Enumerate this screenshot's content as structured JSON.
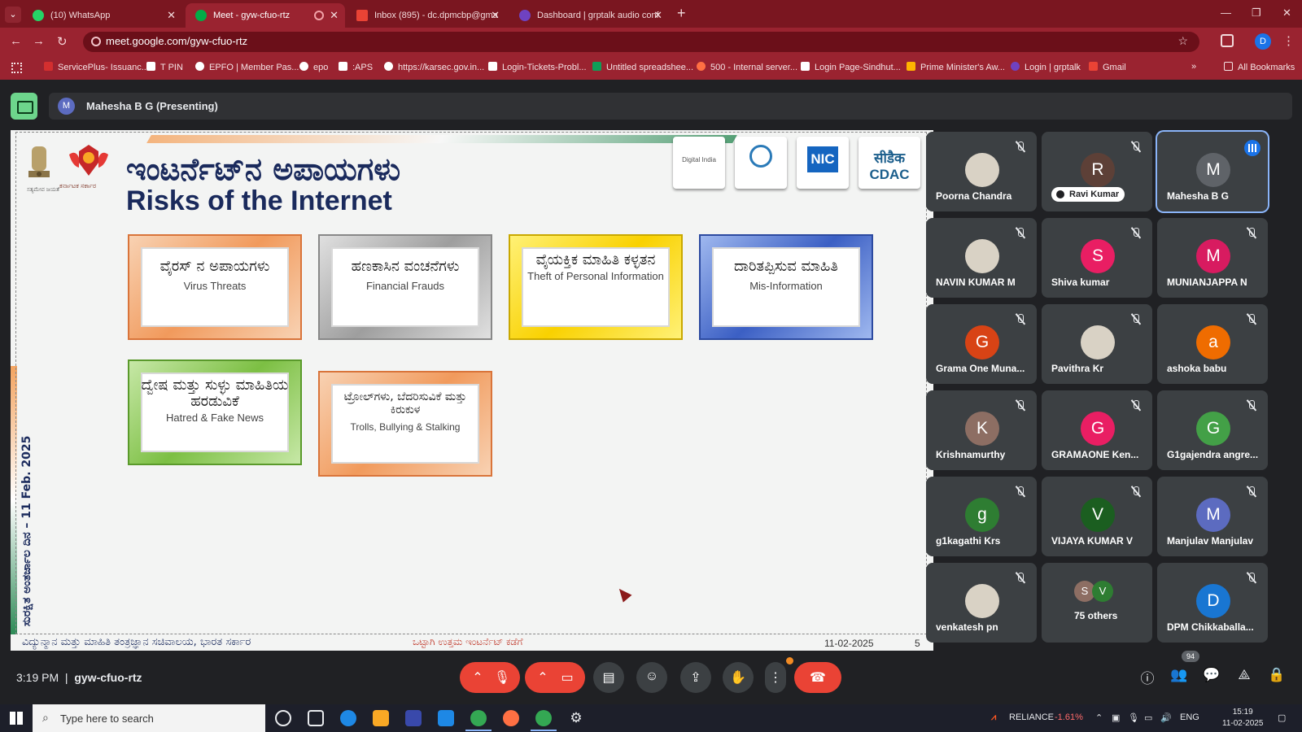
{
  "browser": {
    "tabs": [
      {
        "title": "(10) WhatsApp",
        "color": "#25d366"
      },
      {
        "title": "Meet - gyw-cfuo-rtz",
        "color": "#00ac47"
      },
      {
        "title": "Inbox (895) - dc.dpmcbp@gma",
        "color": "#ea4335"
      },
      {
        "title": "Dashboard | grptalk audio conf",
        "color": "#6f42c1"
      }
    ],
    "url": "meet.google.com/gyw-cfuo-rtz",
    "profile_initial": "D",
    "bookmarks": [
      {
        "label": "ServicePlus- Issuanc...",
        "color": "#d32f2f"
      },
      {
        "label": "T PIN",
        "color": "#ffffff"
      },
      {
        "label": "EPFO | Member Pas...",
        "color": "#ffffff"
      },
      {
        "label": "epo",
        "color": "#ffffff"
      },
      {
        "label": ":APS",
        "color": "#ffffff"
      },
      {
        "label": "https://karsec.gov.in...",
        "color": "#ffffff"
      },
      {
        "label": "Login-Tickets-Probl...",
        "color": "#ffffff"
      },
      {
        "label": "Untitled spreadshee...",
        "color": "#0f9d58"
      },
      {
        "label": "500 - Internal server...",
        "color": "#ff7043"
      },
      {
        "label": "Login Page-Sindhut...",
        "color": "#ffffff"
      },
      {
        "label": "Prime Minister's Aw...",
        "color": "#ffb300"
      },
      {
        "label": "Login | grptalk",
        "color": "#6f42c1"
      },
      {
        "label": "Gmail",
        "color": "#ea4335"
      }
    ],
    "more_bookmarks": "»",
    "all_bookmarks": "All Bookmarks"
  },
  "meet": {
    "presenter_initial": "M",
    "presenter_label": "Mahesha B G (Presenting)",
    "time": "3:19 PM",
    "meeting_code": "gyw-cfuo-rtz",
    "participant_count": "94",
    "participants": [
      {
        "name": "Poorna Chandra",
        "initial": "",
        "color": "#d9d2c5",
        "photo": true
      },
      {
        "name": "Ravi Kumar",
        "initial": "R",
        "color": "#5d4037",
        "pill": true
      },
      {
        "name": "Mahesha B G",
        "initial": "M",
        "color": "#5f6368",
        "active": true
      },
      {
        "name": "NAVIN KUMAR M",
        "initial": "",
        "color": "#d9d2c5",
        "photo": true
      },
      {
        "name": "Shiva kumar",
        "initial": "S",
        "color": "#e91e63"
      },
      {
        "name": "MUNIANJAPPA N",
        "initial": "M",
        "color": "#d81b60"
      },
      {
        "name": "Grama One Muna...",
        "initial": "G",
        "color": "#d84315"
      },
      {
        "name": "Pavithra Kr",
        "initial": "",
        "color": "#d9d2c5",
        "photo": true
      },
      {
        "name": "ashoka babu",
        "initial": "a",
        "color": "#ef6c00"
      },
      {
        "name": "Krishnamurthy",
        "initial": "K",
        "color": "#8d6e63"
      },
      {
        "name": "GRAMAONE Ken...",
        "initial": "G",
        "color": "#e91e63"
      },
      {
        "name": "G1gajendra angre...",
        "initial": "G",
        "color": "#43a047"
      },
      {
        "name": "g1kagathi Krs",
        "initial": "g",
        "color": "#2e7d32"
      },
      {
        "name": "VIJAYA KUMAR V",
        "initial": "V",
        "color": "#1b5e20"
      },
      {
        "name": "Manjulav Manjulav",
        "initial": "M",
        "color": "#5c6bc0"
      },
      {
        "name": "venkatesh pn",
        "initial": "",
        "color": "#d9d2c5",
        "photo": true
      },
      {
        "name": "75 others",
        "initial": "",
        "color": "#3c4043",
        "others": true
      },
      {
        "name": "DPM Chikkaballa...",
        "initial": "D",
        "color": "#1976d2"
      }
    ],
    "others_avatars": [
      "S",
      "V"
    ]
  },
  "slide": {
    "title_kn": "ಇಂಟರ್ನೆಟ್‌ನ ಅಪಾಯಗಳು",
    "title_en": "Risks of the Internet",
    "emblem_caption": "ಸತ್ಯಮೇವ ಜಯತೆ",
    "kar_caption": "ಕರ್ನಾಟಕ ಸರ್ಕಾರ",
    "logos": [
      "Digital India",
      "",
      "NIC",
      "सीडैक CDAC"
    ],
    "cards": [
      {
        "kn": "ವೈರಸ್ ನ ಅಪಾಯಗಳು",
        "en": "Virus Threats",
        "style": "orange"
      },
      {
        "kn": "ಹಣಕಾಸಿನ ವಂಚನೆಗಳು",
        "en": "Financial Frauds",
        "style": "gray"
      },
      {
        "kn": "ವೈಯಕ್ತಿಕ ಮಾಹಿತಿ ಕಳ್ಳತನ",
        "en": "Theft of Personal Information",
        "style": "yellow"
      },
      {
        "kn": "ದಾರಿತಪ್ಪಿಸುವ ಮಾಹಿತಿ",
        "en": "Mis-Information",
        "style": "blue"
      },
      {
        "kn": "ದ್ವೇಷ ಮತ್ತು ಸುಳ್ಳು ಮಾಹಿತಿಯ ಹರಡುವಿಕೆ",
        "en": "Hatred & Fake News",
        "style": "green"
      },
      {
        "kn": "ಟ್ರೋಲ್‌ಗಳು, ಬೆದರಿಸುವಿಕೆ ಮತ್ತು ಕಿರುಕುಳ",
        "en": "Trolls, Bullying & Stalking",
        "style": "orange"
      }
    ],
    "vertical_text": "ಸುರಕ್ಷಿತ ಅಂತರ್ಜಾಲ ದಿನ – 11 Feb. 2025",
    "footer_left": "ವಿದ್ಯುನ್ಮಾನ ಮತ್ತು ಮಾಹಿತಿ ತಂತ್ರಜ್ಞಾನ ಸಚಿವಾಲಯ, ಭಾರತ ಸರ್ಕಾರ",
    "footer_mid": "ಒಟ್ಟಾಗಿ ಉತ್ತಮ ಇಂಟರ್ನೆಟ್ ಕಡೆಗೆ",
    "footer_date": "11-02-2025",
    "footer_num": "5"
  },
  "taskbar": {
    "search_placeholder": "Type here to search",
    "stock_name": "RELIANCE",
    "stock_change": "-1.61%",
    "lang": "ENG",
    "time": "15:19",
    "date": "11-02-2025"
  }
}
